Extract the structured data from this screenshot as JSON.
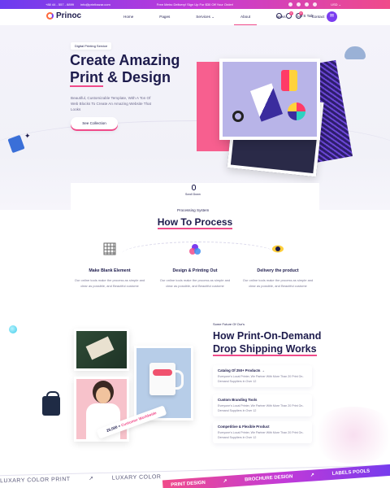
{
  "topbar": {
    "phone": "+88 44 - 557 - 8899",
    "email": "info@printbazar.com",
    "promo": "Free Metro Delivery! Sign Up For $30 Off Your Order!",
    "currency": "USD ⌄",
    "social_icons": [
      "facebook-icon",
      "twitter-icon",
      "instagram-icon",
      "youtube-icon"
    ]
  },
  "header": {
    "logo": "Prinoc",
    "nav": [
      "Home",
      "Pages",
      "Services ⌄",
      "About",
      "News",
      "Contact"
    ],
    "active_nav": "About",
    "cart_count": "0",
    "wishlist_count": "0",
    "talk_label": "Let’S Talk"
  },
  "hero": {
    "tag": "Digital Printing Service",
    "title_line1": "Create Amazing",
    "title_line2_a": "Print",
    "title_line2_b": " & Design",
    "subtitle": "Beautiful, Customizable Template, With A Ton Of Web Blocks To Create An Amazing Website That Looks",
    "cta": "See Collection",
    "scroll_label": "Scroll Down"
  },
  "process": {
    "tag": "Processing System",
    "title": "How To Process",
    "steps": [
      {
        "title": "Make Blank Element",
        "text": "Our online tools make the process as simple and clear as possible, and Beautiful custome"
      },
      {
        "title": "Design & Printing Out",
        "text": "Our online tools make the process as simple and clear as possible, and Beautiful custome"
      },
      {
        "title": "Delivery the product",
        "text": "Our online tools make the process as simple and clear as possible, and Beautiful custome"
      }
    ]
  },
  "dropship": {
    "tag": "Some Future Of Our's",
    "title_line1": "How Print-On-Demand",
    "title_line2": "Drop Shipping Works",
    "ribbon_count": "25,000 +",
    "ribbon_label": "Customer Worldwide",
    "features": [
      {
        "title": "Catalog Of 250+ Products →",
        "text": "Everyone's Local Printer, We Partner With More Than 20 Print On-Demand Suppliers In Over 12"
      },
      {
        "title": "Custom Branding Tools",
        "text": "Everyone's Local Printer, We Partner With More Than 20 Print On-Demand Suppliers In Over 12"
      },
      {
        "title": "Competitive & Flexible Product",
        "text": "Everyone's Local Printer, We Partner With More Than 20 Print On-Demand Suppliers In Over 12"
      }
    ]
  },
  "marquee": {
    "white_items": [
      "LUXARY COLOR PRINT",
      "↗",
      "LUXARY COLOR"
    ],
    "grad_items": [
      "PRINT DESIGN",
      "↗",
      "BROCHURE DESIGN",
      "↗",
      "LABELS POOLS"
    ]
  },
  "colors": {
    "accent": "#f04b8a",
    "brand": "#7b3df0",
    "ink": "#1d1b4c"
  }
}
